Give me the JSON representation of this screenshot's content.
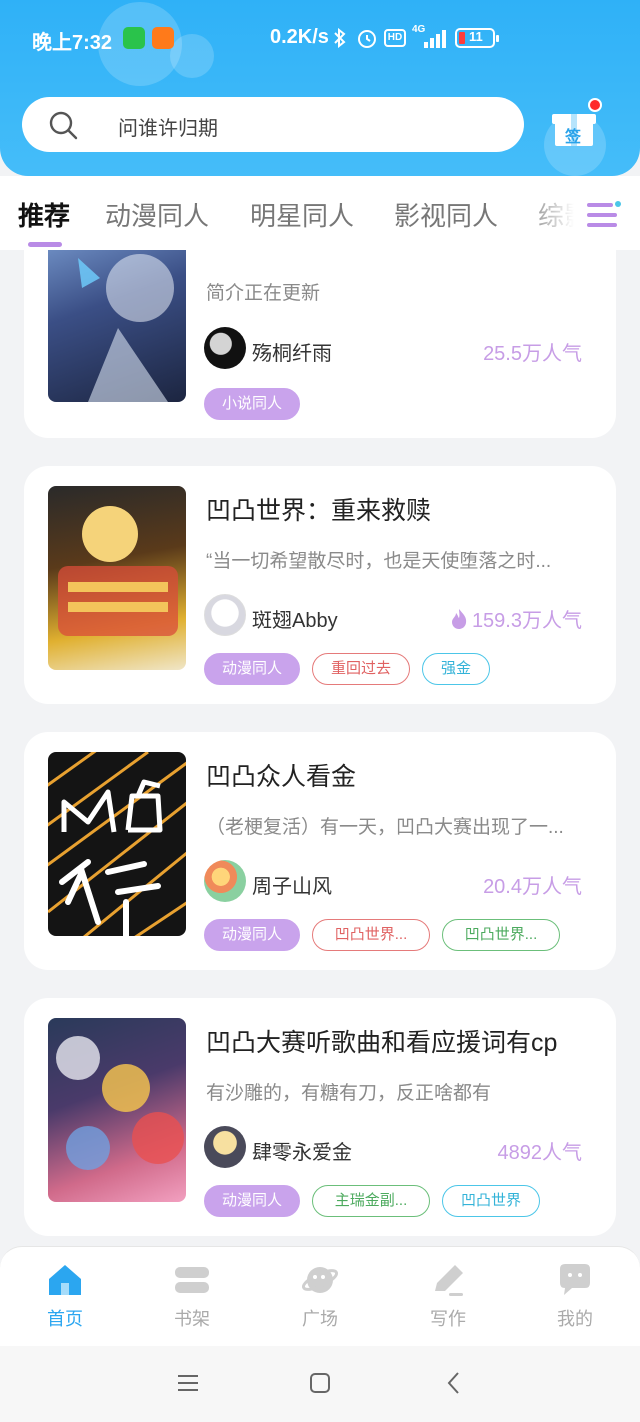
{
  "status_bar": {
    "time": "晚上7:32",
    "net_speed": "0.2K/s",
    "battery": "11",
    "signal": "4G"
  },
  "search": {
    "placeholder": "问谁许归期"
  },
  "checkin": {
    "label": "签"
  },
  "tabs": [
    {
      "label": "推荐",
      "active": true
    },
    {
      "label": "动漫同人"
    },
    {
      "label": "明星同人"
    },
    {
      "label": "影视同人"
    },
    {
      "label": "综影"
    }
  ],
  "cards": [
    {
      "title": "",
      "desc": "简介正在更新",
      "author": "殇桐纤雨",
      "popularity": "25.5万人气",
      "hot": false,
      "tags": [
        {
          "label": "小说同人",
          "style": "filled"
        }
      ]
    },
    {
      "title": "凹凸世界：重来救赎",
      "desc": "“当一切希望散尽时，也是天使堕落之时...",
      "author": "斑翅Abby",
      "popularity": "159.3万人气",
      "hot": true,
      "tags": [
        {
          "label": "动漫同人",
          "style": "filled"
        },
        {
          "label": "重回过去",
          "style": "red"
        },
        {
          "label": "强金",
          "style": "cyan"
        }
      ]
    },
    {
      "title": "凹凸众人看金",
      "desc": "（老梗复活）有一天，凹凸大赛出现了一...",
      "author": "周子山风",
      "popularity": "20.4万人气",
      "hot": false,
      "tags": [
        {
          "label": "动漫同人",
          "style": "filled"
        },
        {
          "label": "凹凸世界...",
          "style": "red"
        },
        {
          "label": "凹凸世界...",
          "style": "green"
        }
      ]
    },
    {
      "title": "凹凸大赛听歌曲和看应援词有cp",
      "desc": "有沙雕的，有糖有刀，反正啥都有",
      "author": "肆零永爱金",
      "popularity": "4892人气",
      "hot": false,
      "tags": [
        {
          "label": "动漫同人",
          "style": "filled"
        },
        {
          "label": "主瑞金副...",
          "style": "green"
        },
        {
          "label": "凹凸世界",
          "style": "cyan"
        }
      ]
    }
  ],
  "bottom_nav": [
    {
      "label": "首页",
      "icon": "home-icon",
      "active": true
    },
    {
      "label": "书架",
      "icon": "bookshelf-icon"
    },
    {
      "label": "广场",
      "icon": "planet-icon"
    },
    {
      "label": "写作",
      "icon": "pen-icon"
    },
    {
      "label": "我的",
      "icon": "profile-chat-icon"
    }
  ],
  "colors": {
    "header_blue": "#2fb1f7",
    "accent_purple": "#c9a3ec",
    "nav_active": "#2ba6f0",
    "popularity": "#c79de6"
  }
}
